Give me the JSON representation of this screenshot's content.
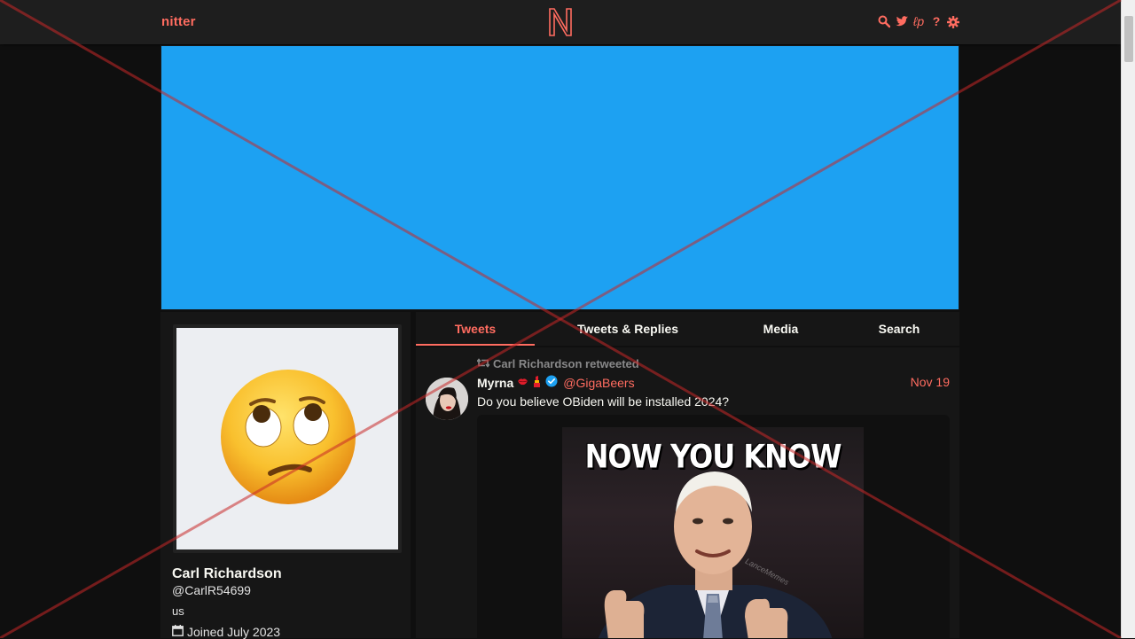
{
  "navbar": {
    "brand": "nitter",
    "logo_icon": "nitter-n-logo-icon",
    "icons": [
      "search-icon",
      "twitter-bird-icon",
      "rss-icon",
      "help-icon",
      "gear-icon"
    ],
    "rss_glyph": "ℓp",
    "help_glyph": "?"
  },
  "colors": {
    "accent": "#ff6c60",
    "banner": "#1da1f2",
    "background": "#0f0f0f",
    "panel": "#161616"
  },
  "profile": {
    "fullname": "Carl Richardson",
    "username": "@CarlR54699",
    "bio": "us",
    "joined": "Joined July 2023",
    "avatar_icon": "eye-roll-emoji-avatar"
  },
  "tabs": [
    {
      "label": "Tweets",
      "active": true
    },
    {
      "label": "Tweets & Replies",
      "active": false
    },
    {
      "label": "Media",
      "active": false
    },
    {
      "label": "Search",
      "active": false
    }
  ],
  "tweet": {
    "retweet_header": "Carl Richardson retweeted",
    "fullname": "Myrna",
    "emojis": [
      "lips-emoji-icon",
      "lipstick-emoji-icon"
    ],
    "verified": true,
    "username": "@GigaBeers",
    "date": "Nov 19",
    "content": "Do you believe OBiden will be installed 2024?",
    "image": {
      "caption": "NOW YOU KNOW",
      "watermark": "LanceMemes"
    }
  }
}
